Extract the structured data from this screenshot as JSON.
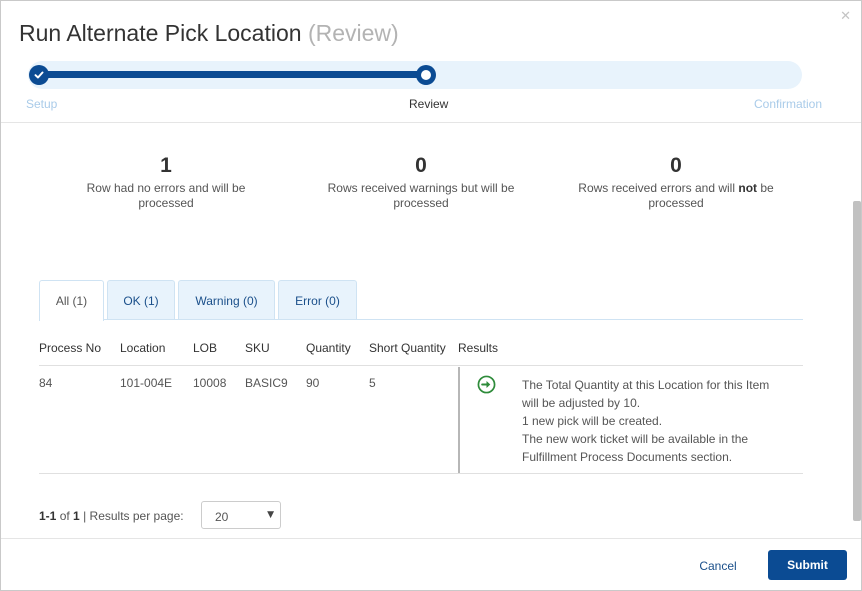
{
  "dialog": {
    "title": "Run Alternate Pick Location",
    "title_suffix": "(Review)",
    "close_icon": "close-icon"
  },
  "steps": {
    "items": [
      {
        "label": "Setup",
        "state": "done"
      },
      {
        "label": "Review",
        "state": "current"
      },
      {
        "label": "Confirmation",
        "state": "pending"
      }
    ],
    "progress": 0.5
  },
  "summary": [
    {
      "count": "1",
      "line1": "Row had no errors and will be",
      "line2": "processed"
    },
    {
      "count": "0",
      "line1": "Rows received warnings but will be",
      "line2": "processed"
    },
    {
      "count": "0",
      "line1_pre": "Rows received errors and will ",
      "line1_bold": "not",
      "line1_post": " be",
      "line2": "processed"
    }
  ],
  "tabs": [
    {
      "label": "All (1)",
      "active": true
    },
    {
      "label": "OK (1)",
      "active": false
    },
    {
      "label": "Warning (0)",
      "active": false
    },
    {
      "label": "Error (0)",
      "active": false
    }
  ],
  "table": {
    "columns": [
      "Process No",
      "Location",
      "LOB",
      "SKU",
      "Quantity",
      "Short Quantity",
      "Results"
    ],
    "rows": [
      {
        "process_no": "84",
        "location": "101-004E",
        "lob": "10008",
        "sku": "BASIC9",
        "quantity": "90",
        "short_quantity": "5",
        "result_icon": "arrow-right-circle-icon",
        "result_lines": [
          "The Total Quantity at this Location for this Item",
          "will be adjusted by 10.",
          "1 new pick will be created.",
          "The new work ticket will be available in the",
          "Fulfillment Process Documents section."
        ]
      }
    ]
  },
  "pagination": {
    "range": "1-1",
    "of_label": "of",
    "total": "1",
    "per_page_label": "| Results per page:",
    "per_page_value": "20"
  },
  "footer": {
    "cancel_label": "Cancel",
    "submit_label": "Submit"
  },
  "colors": {
    "primary": "#0b4b93",
    "track": "#e8f3fc",
    "result_icon": "#2e8b3a"
  }
}
